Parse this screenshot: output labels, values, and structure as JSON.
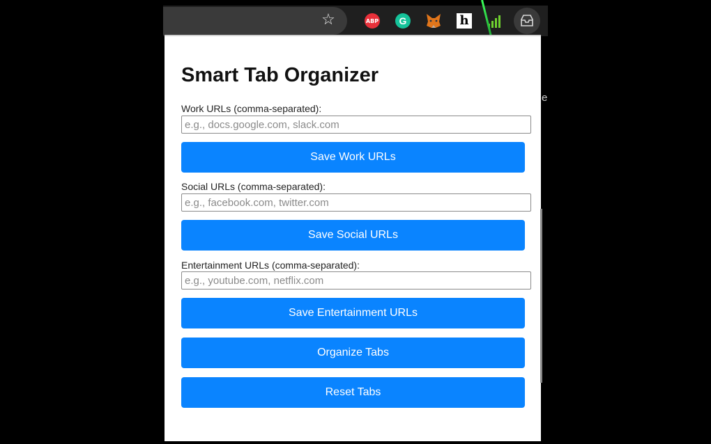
{
  "browser": {
    "icons": [
      "star-icon",
      "adblock-plus-icon",
      "grammarly-icon",
      "metamask-fox-icon",
      "honey-h-icon",
      "signal-bars-icon",
      "inbox-tray-icon"
    ],
    "abp_label": "ABP",
    "g_label": "G",
    "h_label": "h",
    "side_letter": "e"
  },
  "popup": {
    "title": "Smart Tab Organizer",
    "work": {
      "label": "Work URLs (comma-separated):",
      "placeholder": "e.g., docs.google.com, slack.com",
      "value": "",
      "button": "Save Work URLs"
    },
    "social": {
      "label": "Social URLs (comma-separated):",
      "placeholder": "e.g., facebook.com, twitter.com",
      "value": "",
      "button": "Save Social URLs"
    },
    "entertainment": {
      "label": "Entertainment URLs (comma-separated):",
      "placeholder": "e.g., youtube.com, netflix.com",
      "value": "",
      "button": "Save Entertainment URLs"
    },
    "organize_button": "Organize Tabs",
    "reset_button": "Reset Tabs"
  },
  "colors": {
    "button_blue": "#0a84ff",
    "popup_bg": "#ffffff",
    "toolbar_bg": "#1f1f1f"
  }
}
